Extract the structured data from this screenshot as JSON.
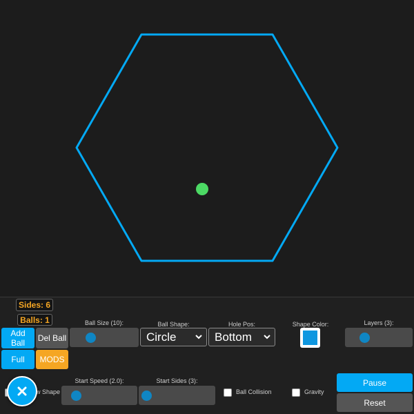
{
  "colors": {
    "background": "#1c1c1c",
    "shape_stroke": "#03a9f4",
    "ball": "#4cd964",
    "accent_blue": "#03a9f4",
    "accent_orange": "#f5a623",
    "shape_color_value": "#0f97e0"
  },
  "stats": {
    "sides": "Sides: 6",
    "balls": "Balls: 1"
  },
  "buttons": {
    "add_ball": "Add Ball",
    "del_ball": "Del Ball",
    "full": "Full",
    "mods": "MODS",
    "pause": "Pause",
    "reset": "Reset",
    "fab_icon": "close-icon"
  },
  "controls": {
    "ball_size": {
      "label": "Ball Size (10):",
      "level": 0.0
    },
    "ball_shape": {
      "label": "Ball Shape:",
      "value": "Circle"
    },
    "hole_pos": {
      "label": "Hole Pos:",
      "value": "Bottom"
    },
    "shape_color": {
      "label": "Shape Color:"
    },
    "layers": {
      "label": "Layers (3):",
      "level": 0.1
    },
    "show_shape": {
      "label": "w Shape"
    },
    "start_speed": {
      "label": "Start Speed (2.0):",
      "level": 0.05
    },
    "start_sides": {
      "label": "Start Sides (3):",
      "level": 0.0
    },
    "ball_collision": {
      "label": "Ball Collision",
      "checked": false
    },
    "gravity": {
      "label": "Gravity",
      "checked": false
    }
  }
}
